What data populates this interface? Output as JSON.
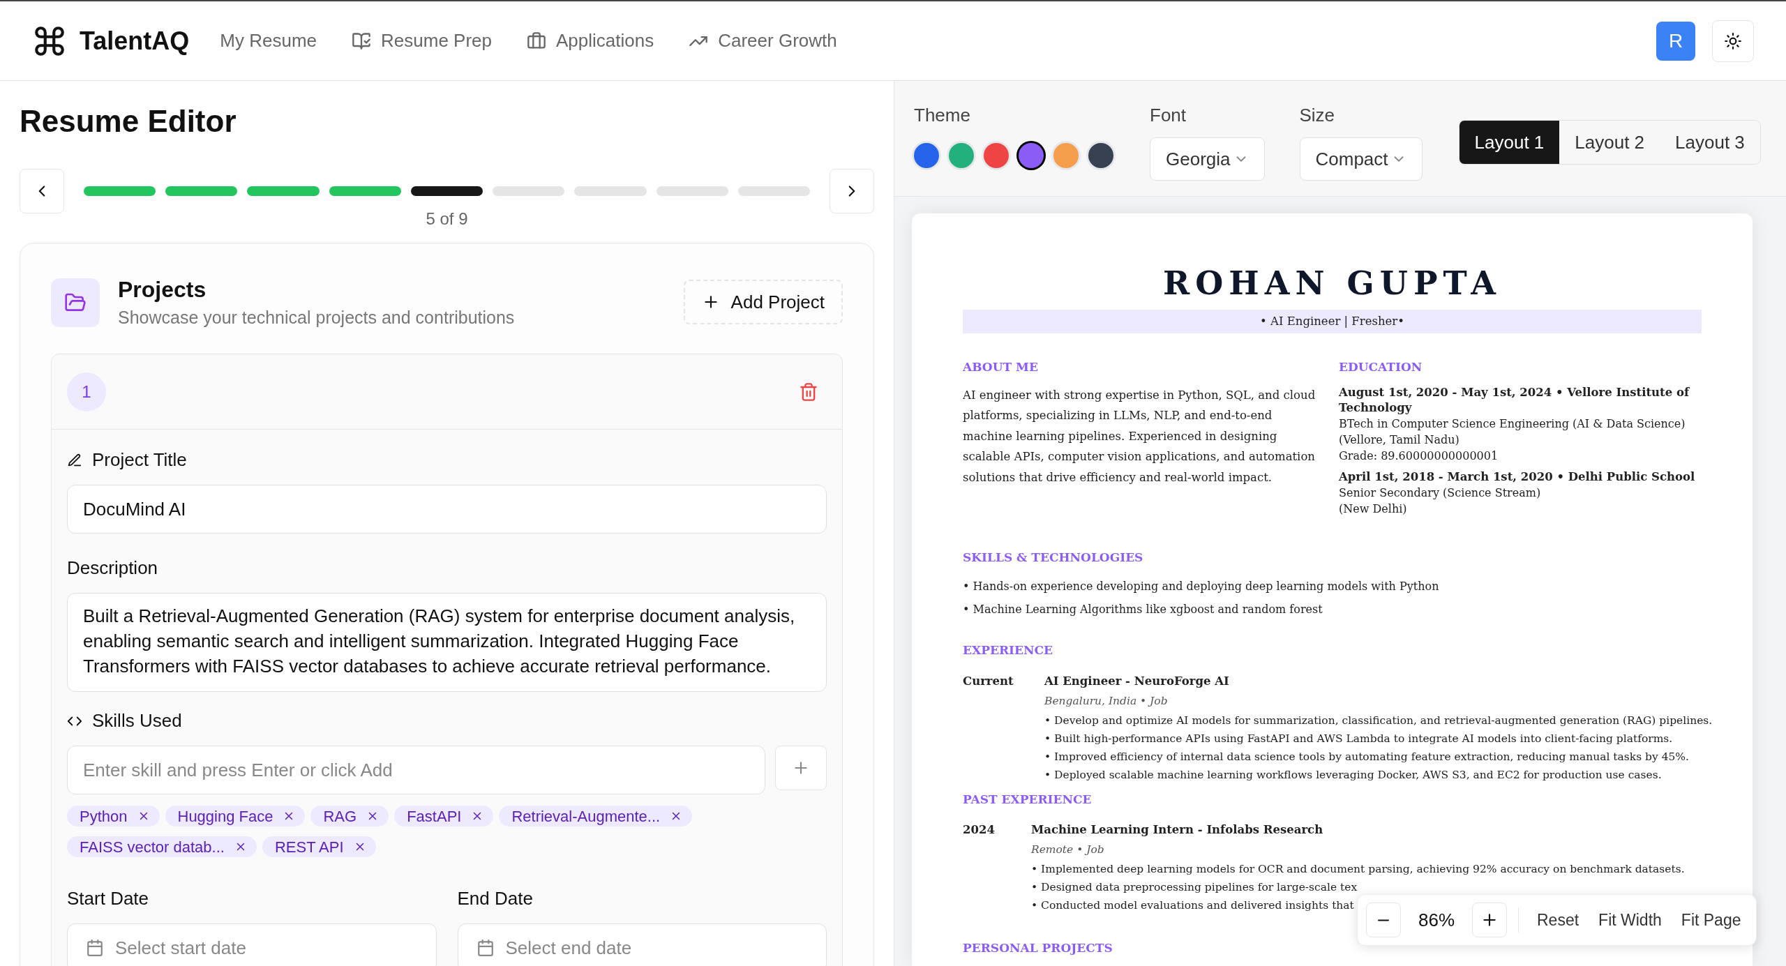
{
  "brand": {
    "name": "TalentAQ"
  },
  "nav": [
    {
      "label": "My Resume"
    },
    {
      "label": "Resume Prep"
    },
    {
      "label": "Applications"
    },
    {
      "label": "Career Growth"
    }
  ],
  "avatar": "R",
  "editor": {
    "title": "Resume Editor",
    "step_label": "5 of 9",
    "steps": [
      {
        "completed": true,
        "selected": false
      },
      {
        "completed": true,
        "selected": false
      },
      {
        "completed": true,
        "selected": false
      },
      {
        "completed": true,
        "selected": false
      },
      {
        "completed": false,
        "selected": true
      },
      {
        "completed": false,
        "selected": false
      },
      {
        "completed": false,
        "selected": false
      },
      {
        "completed": false,
        "selected": false
      },
      {
        "completed": false,
        "selected": false
      }
    ]
  },
  "section": {
    "title": "Projects",
    "subtitle": "Showcase your technical projects and contributions",
    "add_button": "Add Project"
  },
  "project": {
    "number": "1",
    "title_label": "Project Title",
    "title_value": "DocuMind AI",
    "description_label": "Description",
    "description": "Built a Retrieval-Augmented Generation (RAG) system for enterprise document analysis, enabling semantic search and intelligent summarization. Integrated Hugging Face Transformers with FAISS vector databases to achieve accurate retrieval performance.",
    "skills_label": "Skills Used",
    "skills_placeholder": "Enter skill and press Enter or click Add",
    "skills": [
      "Python",
      "Hugging Face",
      "RAG",
      "FastAPI",
      "Retrieval-Augmente...",
      "FAISS vector datab...",
      "REST API"
    ],
    "start_label": "Start Date",
    "start_placeholder": "Select start date",
    "end_label": "End Date",
    "end_placeholder": "Select end date"
  },
  "toolbar": {
    "theme_label": "Theme",
    "themes": [
      {
        "color": "#2563eb",
        "selected": false
      },
      {
        "color": "#22b07d",
        "selected": false
      },
      {
        "color": "#ef4444",
        "selected": false
      },
      {
        "color": "#8b5cf6",
        "selected": true
      },
      {
        "color": "#f59e4b",
        "selected": false
      },
      {
        "color": "#374151",
        "selected": false
      }
    ],
    "font_label": "Font",
    "font_value": "Georgia",
    "size_label": "Size",
    "size_value": "Compact",
    "layouts": [
      {
        "label": "Layout 1",
        "selected": true
      },
      {
        "label": "Layout 2",
        "selected": false
      },
      {
        "label": "Layout 3",
        "selected": false
      }
    ]
  },
  "resume": {
    "name": "ROHAN GUPTA",
    "tagline": "• AI Engineer | Fresher•",
    "about": {
      "heading": "ABOUT ME",
      "text": "AI engineer with strong expertise in Python, SQL, and cloud platforms, specializing in LLMs, NLP, and end-to-end machine learning pipelines. Experienced in designing scalable APIs, computer vision applications, and automation solutions that drive efficiency and real-world impact."
    },
    "education": {
      "heading": "EDUCATION",
      "entries": [
        {
          "title": "August 1st, 2020 - May 1st, 2024 • Vellore Institute of Technology",
          "lines": [
            "BTech in Computer Science Engineering (AI & Data Science)",
            "(Vellore, Tamil Nadu)",
            "Grade: 89.60000000000001"
          ]
        },
        {
          "title": "April 1st, 2018 - March 1st, 2020 • Delhi Public School",
          "lines": [
            "Senior Secondary (Science Stream)",
            "(New Delhi)"
          ]
        }
      ]
    },
    "skills": {
      "heading": "SKILLS & TECHNOLOGIES",
      "items": [
        "• Hands-on experience developing and deploying deep learning models with Python",
        "• Machine Learning Algorithms like xgboost and random forest"
      ]
    },
    "experience": {
      "heading": "EXPERIENCE",
      "entries": [
        {
          "date": "Current",
          "title": "AI Engineer - NeuroForge AI",
          "meta": "Bengaluru, India • Job",
          "bullets": [
            "• Develop and optimize AI models for summarization, classification, and retrieval-augmented generation (RAG) pipelines.",
            "• Built high-performance APIs using FastAPI and AWS Lambda to integrate AI models into client-facing platforms.",
            "• Improved efficiency of internal data science tools by automating feature extraction, reducing manual tasks by 45%.",
            "• Deployed scalable machine learning workflows leveraging Docker, AWS S3, and EC2 for production use cases."
          ]
        }
      ]
    },
    "past_experience": {
      "heading": "PAST EXPERIENCE",
      "entries": [
        {
          "date": "2024",
          "title": "Machine Learning Intern - Infolabs Research",
          "meta": "Remote • Job",
          "bullets": [
            "• Implemented deep learning models for OCR and document parsing, achieving 92% accuracy on benchmark datasets.",
            "• Designed data preprocessing pipelines for large-scale tex",
            "• Conducted model evaluations and delivered insights that"
          ]
        }
      ]
    },
    "personal_projects": {
      "heading": "PERSONAL PROJECTS"
    }
  },
  "zoom": {
    "level": "86%",
    "buttons": [
      "Reset",
      "Fit Width",
      "Fit Page"
    ]
  }
}
